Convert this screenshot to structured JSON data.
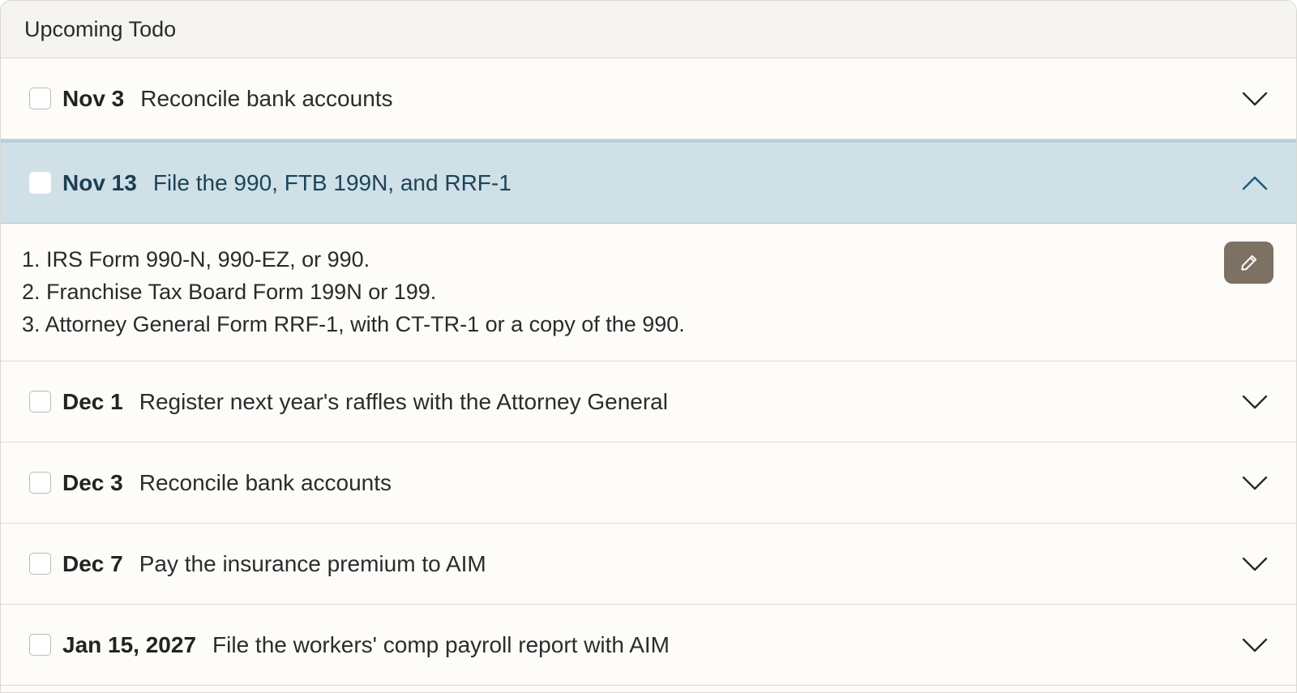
{
  "header": {
    "title": "Upcoming Todo"
  },
  "todos": [
    {
      "date": "Nov 3",
      "title": "Reconcile bank accounts"
    },
    {
      "date": "Nov 13",
      "title": "File the 990, FTB 199N, and RRF-1"
    },
    {
      "date": "Dec 1",
      "title": "Register next year's raffles with the Attorney General"
    },
    {
      "date": "Dec 3",
      "title": "Reconcile bank accounts"
    },
    {
      "date": "Dec 7",
      "title": "Pay the insurance premium to AIM"
    },
    {
      "date": "Jan 15, 2027",
      "title": "File the workers' comp payroll report with AIM"
    }
  ],
  "expanded_details": {
    "items": [
      "1. IRS Form 990-N, 990-EZ, or 990.",
      "2. Franchise Tax Board Form 199N or 199.",
      "3. Attorney General Form RRF-1, with CT-TR-1 or a copy of the 990."
    ],
    "edit_icon": "pencil-icon"
  },
  "icons": {
    "collapsed": "chevron-down-icon",
    "expanded": "chevron-up-icon"
  },
  "colors": {
    "expanded_row_bg": "#cfe0e7",
    "expanded_text": "#1d4457",
    "edit_button_bg": "#7c7163",
    "card_bg": "#fdfcf9",
    "header_bg": "#f5f4f1"
  }
}
